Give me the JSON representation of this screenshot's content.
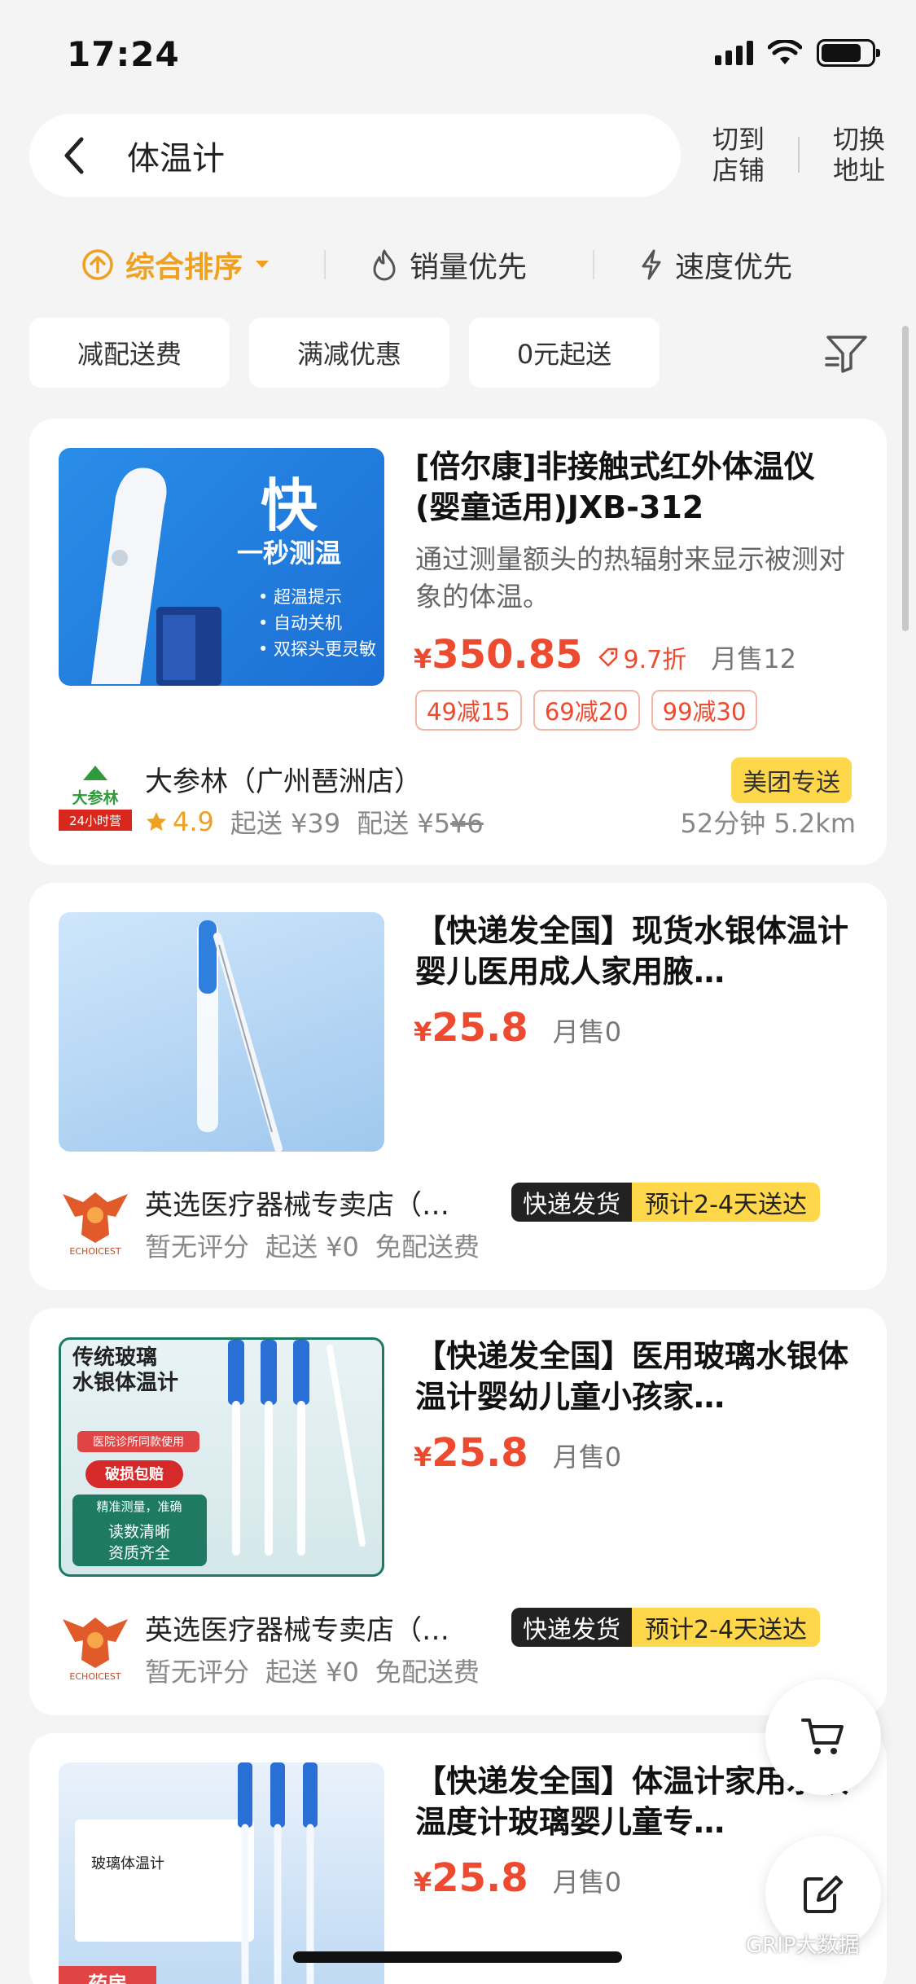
{
  "status_bar": {
    "time": "17:24"
  },
  "search": {
    "query": "体温计"
  },
  "header": {
    "switch_store": "切到\n店铺",
    "switch_address": "切换\n地址"
  },
  "sort": {
    "items": [
      {
        "label": "综合排序"
      },
      {
        "label": "销量优先"
      },
      {
        "label": "速度优先"
      }
    ]
  },
  "filters": {
    "chips": [
      {
        "label": "减配送费"
      },
      {
        "label": "满减优惠"
      },
      {
        "label": "0元起送"
      }
    ]
  },
  "colors": {
    "accent": "#f0a020",
    "price": "#ee4a2f",
    "badge_yellow": "#ffd74a"
  },
  "products": [
    {
      "title": "[倍尔康]非接触式红外体温仪 (婴童适用)JXB-312",
      "desc": "通过测量额头的热辐射来显示被测对象的体温。",
      "currency": "¥",
      "price": "350.85",
      "discount": "9.7折",
      "sold": "月售12",
      "coupons": [
        "49减15",
        "69减20",
        "99减30"
      ],
      "image_text": {
        "big": "快",
        "sub": "一秒测温",
        "bullets": [
          "• 超温提示",
          "• 自动关机",
          "• 双探头更灵敏"
        ]
      },
      "shop": {
        "name": "大参林（广州琶洲店）",
        "rating": "4.9",
        "min_order": "起送 ¥39",
        "delivery_fee_label": "配送 ¥5",
        "delivery_fee_original": "¥6",
        "badge": "美团专送",
        "time_distance": "52分钟  5.2km",
        "logo_text": "大参林",
        "logo_sub": "24小时营"
      }
    },
    {
      "title": "【快递发全国】现货水银体温计婴儿医用成人家用腋…",
      "currency": "¥",
      "price": "25.8",
      "sold": "月售0",
      "shop": {
        "name": "英选医疗器械专卖店（…",
        "rating_text": "暂无评分",
        "min_order": "起送 ¥0",
        "delivery_fee_label": "免配送费",
        "express_dark": "快递发货",
        "express_yellow": "预计2-4天送达",
        "logo_sub": "ECHOICEST"
      }
    },
    {
      "title": "【快递发全国】医用玻璃水银体温计婴幼儿童小孩家…",
      "currency": "¥",
      "price": "25.8",
      "sold": "月售0",
      "image_text": {
        "title": "传统玻璃\n水银体温计",
        "tag": "医院诊所同款使用",
        "button": "破损包赔",
        "line1": "精准测量，准确",
        "line2": "读数清晰",
        "line3": "资质齐全"
      },
      "shop": {
        "name": "英选医疗器械专卖店（…",
        "rating_text": "暂无评分",
        "min_order": "起送 ¥0",
        "delivery_fee_label": "免配送费",
        "express_dark": "快递发货",
        "express_yellow": "预计2-4天送达",
        "logo_sub": "ECHOICEST"
      }
    },
    {
      "title": "【快递发全国】体温计家用水银温度计玻璃婴儿童专…",
      "currency": "¥",
      "price": "25.8",
      "sold": "月售0",
      "image_text": {
        "box": "玻璃体温计",
        "banner": "药房"
      }
    }
  ],
  "watermark": "GRIP大数据"
}
